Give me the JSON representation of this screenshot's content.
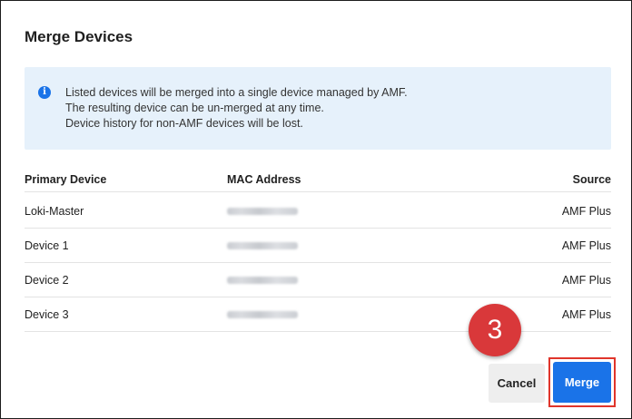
{
  "dialog": {
    "title": "Merge Devices"
  },
  "info_banner": {
    "icon": "info-icon",
    "icon_glyph": "i",
    "lines": [
      "Listed devices will be merged into a single device managed by AMF.",
      "The resulting device can be un-merged at any time.",
      "Device history for non-AMF devices will be lost."
    ]
  },
  "table": {
    "headers": {
      "name": "Primary Device",
      "mac": "MAC Address",
      "source": "Source"
    },
    "rows": [
      {
        "name": "Loki-Master",
        "source": "AMF Plus"
      },
      {
        "name": "Device 1",
        "source": "AMF Plus"
      },
      {
        "name": "Device 2",
        "source": "AMF Plus"
      },
      {
        "name": "Device 3",
        "source": "AMF Plus"
      }
    ]
  },
  "annotation": {
    "step_number": "3",
    "color": "#d9383a"
  },
  "actions": {
    "cancel_label": "Cancel",
    "merge_label": "Merge",
    "merge_color": "#1a73e8",
    "highlight_color": "#e0352b"
  }
}
